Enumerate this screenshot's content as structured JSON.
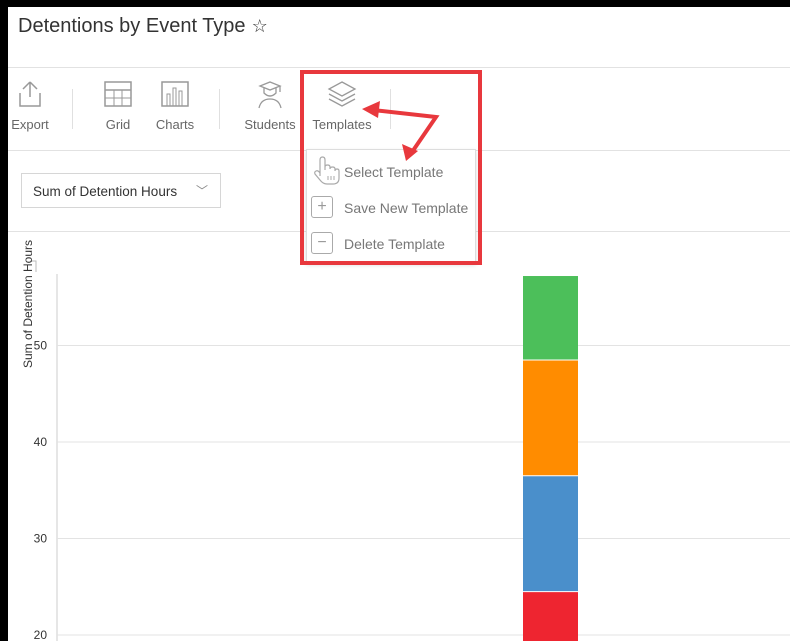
{
  "header": {
    "title": "Detentions by Event Type"
  },
  "toolbar": {
    "export_label": "Export",
    "grid_label": "Grid",
    "charts_label": "Charts",
    "students_label": "Students",
    "templates_label": "Templates"
  },
  "measure_select": {
    "value": "Sum of Detention Hours"
  },
  "templates_menu": {
    "items": [
      {
        "label": "Select Template"
      },
      {
        "label": "Save New Template"
      },
      {
        "label": "Delete Template"
      }
    ]
  },
  "chart_data": {
    "type": "bar",
    "ylabel": "Sum of Detention Hours",
    "ylim": [
      20,
      57
    ],
    "yticks": [
      20,
      30,
      40,
      50
    ],
    "grid": true,
    "series": [
      {
        "values": [
          24.5
        ],
        "color": "#ee2530"
      },
      {
        "values": [
          12
        ],
        "color": "#4a8fcb"
      },
      {
        "values": [
          12
        ],
        "color": "#ff8c00"
      },
      {
        "values": [
          8.7
        ],
        "color": "#4cbf5a"
      }
    ]
  },
  "colors": {
    "annotation": "#e8383d"
  }
}
